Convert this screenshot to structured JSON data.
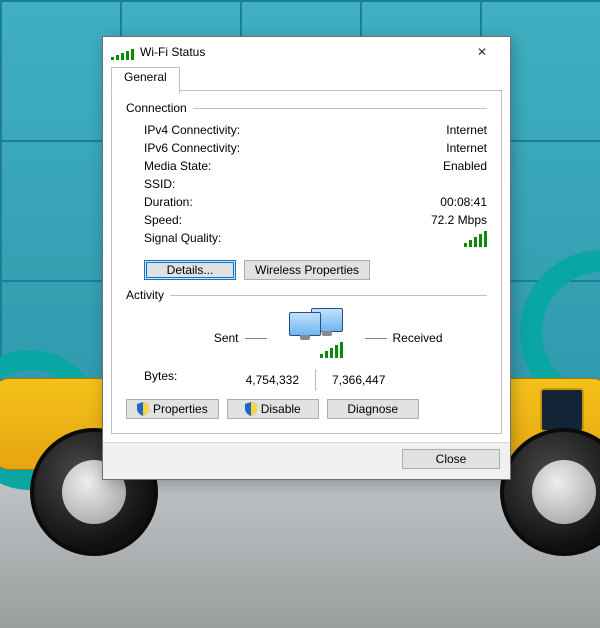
{
  "window": {
    "title": "Wi-Fi Status",
    "tab": "General",
    "close_glyph": "✕"
  },
  "connection": {
    "heading": "Connection",
    "ipv4_label": "IPv4 Connectivity:",
    "ipv4_value": "Internet",
    "ipv6_label": "IPv6 Connectivity:",
    "ipv6_value": "Internet",
    "media_label": "Media State:",
    "media_value": "Enabled",
    "ssid_label": "SSID:",
    "duration_label": "Duration:",
    "duration_value": "00:08:41",
    "speed_label": "Speed:",
    "speed_value": "72.2 Mbps",
    "signal_label": "Signal Quality:",
    "details_btn": "Details...",
    "wireless_btn": "Wireless Properties"
  },
  "activity": {
    "heading": "Activity",
    "sent_label": "Sent",
    "received_label": "Received",
    "bytes_label": "Bytes:",
    "sent_value": "4,754,332",
    "received_value": "7,366,447"
  },
  "buttons": {
    "properties": "Properties",
    "disable": "Disable",
    "diagnose": "Diagnose",
    "close": "Close"
  }
}
